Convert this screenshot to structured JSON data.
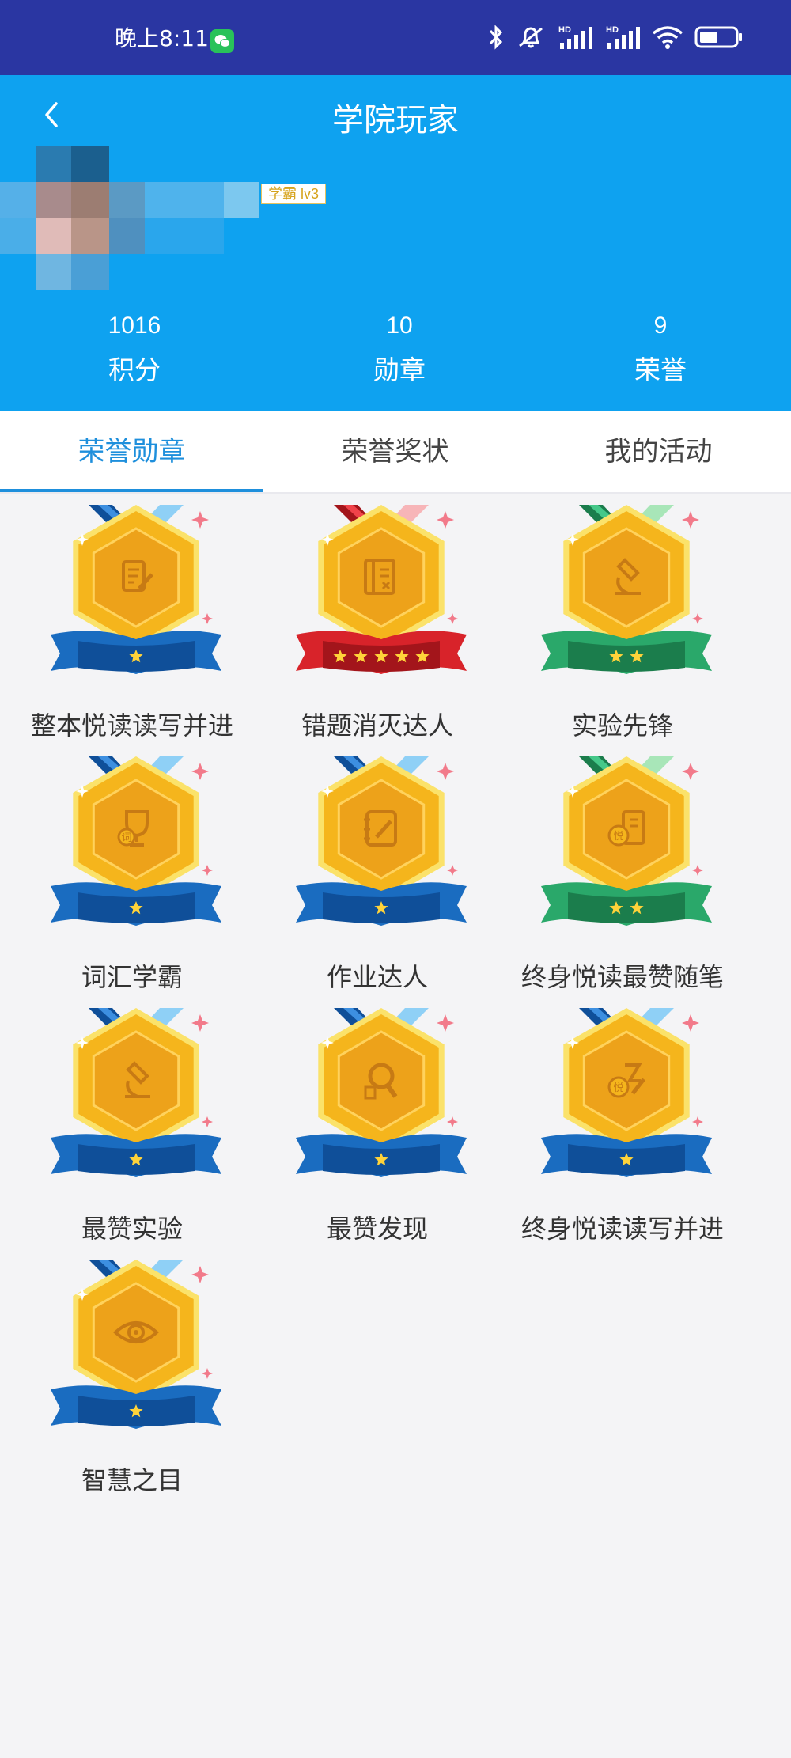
{
  "status_bar": {
    "time": "晚上8:11",
    "signal_label_1": "HD",
    "signal_label_2": "HD"
  },
  "header": {
    "title": "学院玩家",
    "level_badge": "学霸 lv3"
  },
  "stats": [
    {
      "value": "1016",
      "label": "积分"
    },
    {
      "value": "10",
      "label": "勋章"
    },
    {
      "value": "9",
      "label": "荣誉"
    }
  ],
  "tabs": [
    {
      "label": "荣誉勋章",
      "active": true
    },
    {
      "label": "荣誉奖状",
      "active": false
    },
    {
      "label": "我的活动",
      "active": false
    }
  ],
  "medals": [
    {
      "name": "整本悦读读写并进",
      "ribbon": "blue",
      "stars": 1,
      "icon": "document-pen-icon"
    },
    {
      "name": "错题消灭达人",
      "ribbon": "red",
      "stars": 5,
      "icon": "book-cross-icon"
    },
    {
      "name": "实验先锋",
      "ribbon": "green",
      "stars": 2,
      "icon": "microscope-icon"
    },
    {
      "name": "词汇学霸",
      "ribbon": "blue",
      "stars": 1,
      "icon": "trophy-icon"
    },
    {
      "name": "作业达人",
      "ribbon": "blue",
      "stars": 1,
      "icon": "notebook-pen-icon"
    },
    {
      "name": "终身悦读最赞随笔",
      "ribbon": "green",
      "stars": 2,
      "icon": "reading-note-icon"
    },
    {
      "name": "最赞实验",
      "ribbon": "blue",
      "stars": 1,
      "icon": "microscope-icon"
    },
    {
      "name": "最赞发现",
      "ribbon": "blue",
      "stars": 1,
      "icon": "magnifier-thumb-icon"
    },
    {
      "name": "终身悦读读写并进",
      "ribbon": "blue",
      "stars": 1,
      "icon": "reading-write-icon"
    },
    {
      "name": "智慧之目",
      "ribbon": "blue",
      "stars": 1,
      "icon": "eye-icon"
    }
  ],
  "colors": {
    "status_bar": "#2a36a2",
    "header": "#0ea2f0",
    "accent": "#1e8fdc",
    "medal_gold": "#f5b51c",
    "ribbon_blue": "#1a6cc0",
    "ribbon_red": "#d8232a",
    "ribbon_green": "#2aa86a"
  }
}
